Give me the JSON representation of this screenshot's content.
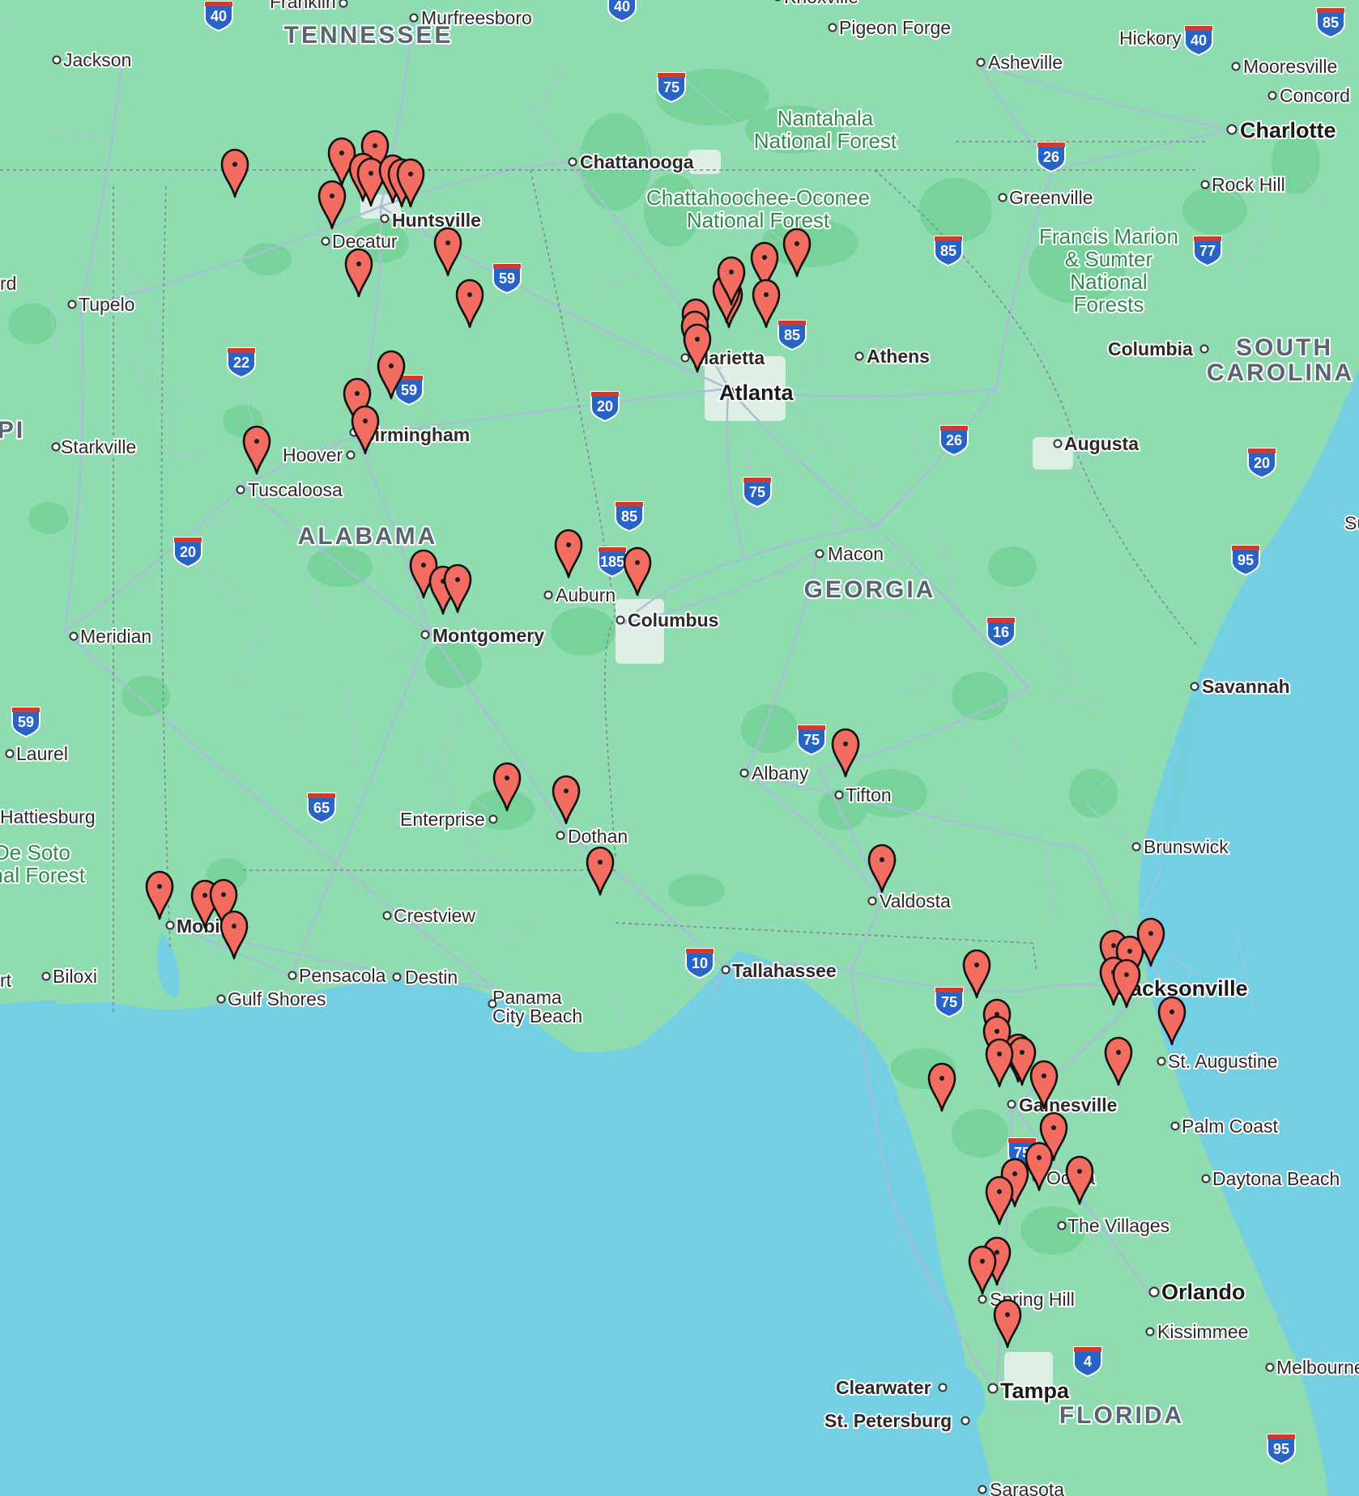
{
  "map": {
    "colors": {
      "water": "#74cfe2",
      "land": "#8fdcb0",
      "forest": "#6fcc93",
      "roads": "#a5b7d4",
      "border": "#7d8a8a",
      "urban": "#e3ecea",
      "marker": "#f26d60",
      "marker_outline": "#111111",
      "interstate": "#2864c5",
      "interstate_top": "#d23a2f"
    },
    "states": [
      {
        "name": "TENNESSEE"
      },
      {
        "name": "ALABAMA"
      },
      {
        "name": "GEORGIA"
      },
      {
        "name": "SOUTH"
      },
      {
        "name": "CAROLINA"
      },
      {
        "name": "FLORIDA"
      },
      {
        "name": "PI"
      }
    ],
    "forests": [
      {
        "name": "Nantahala"
      },
      {
        "name": "National Forest"
      },
      {
        "name": "Chattahoochee-Oconee"
      },
      {
        "name": "National Forest"
      },
      {
        "name": "Francis Marion"
      },
      {
        "name": "& Sumter"
      },
      {
        "name": "National"
      },
      {
        "name": "Forests"
      },
      {
        "name": "De Soto"
      },
      {
        "name": "onal Forest"
      }
    ],
    "cities": [
      {
        "name": "Franklin"
      },
      {
        "name": "Murfreesboro"
      },
      {
        "name": "Knoxville"
      },
      {
        "name": "Pigeon Forge"
      },
      {
        "name": "Hickory"
      },
      {
        "name": "Asheville"
      },
      {
        "name": "Mooresville"
      },
      {
        "name": "Concord"
      },
      {
        "name": "Charlotte"
      },
      {
        "name": "Jackson"
      },
      {
        "name": "Chattanooga"
      },
      {
        "name": "Rock Hill"
      },
      {
        "name": "Greenville"
      },
      {
        "name": "Huntsville"
      },
      {
        "name": "Decatur"
      },
      {
        "name": "rd"
      },
      {
        "name": "Tupelo"
      },
      {
        "name": "Columbia"
      },
      {
        "name": "Marietta"
      },
      {
        "name": "Athens"
      },
      {
        "name": "Atlanta"
      },
      {
        "name": "Birmingham"
      },
      {
        "name": "Hoover"
      },
      {
        "name": "Starkville"
      },
      {
        "name": "Augusta"
      },
      {
        "name": "Tuscaloosa"
      },
      {
        "name": "Sur"
      },
      {
        "name": "Macon"
      },
      {
        "name": "Auburn"
      },
      {
        "name": "Columbus"
      },
      {
        "name": "Montgomery"
      },
      {
        "name": "Meridian"
      },
      {
        "name": "Savannah"
      },
      {
        "name": "Laurel"
      },
      {
        "name": "Albany"
      },
      {
        "name": "Tifton"
      },
      {
        "name": "Hattiesburg"
      },
      {
        "name": "Enterprise"
      },
      {
        "name": "Dothan"
      },
      {
        "name": "Brunswick"
      },
      {
        "name": "Valdosta"
      },
      {
        "name": "Mobile"
      },
      {
        "name": "Crestview"
      },
      {
        "name": "Biloxi"
      },
      {
        "name": "rt"
      },
      {
        "name": "Pensacola"
      },
      {
        "name": "Destin"
      },
      {
        "name": "Tallahassee"
      },
      {
        "name": "Jacksonville"
      },
      {
        "name": "Gulf Shores"
      },
      {
        "name": "Panama"
      },
      {
        "name": "City Beach"
      },
      {
        "name": "St. Augustine"
      },
      {
        "name": "Gainesville"
      },
      {
        "name": "Palm Coast"
      },
      {
        "name": "Ocala"
      },
      {
        "name": "Daytona Beach"
      },
      {
        "name": "The Villages"
      },
      {
        "name": "Orlando"
      },
      {
        "name": "Spring Hill"
      },
      {
        "name": "Kissimmee"
      },
      {
        "name": "Clearwater"
      },
      {
        "name": "Tampa"
      },
      {
        "name": "Melbourne"
      },
      {
        "name": "St. Petersburg"
      },
      {
        "name": "Sarasota"
      }
    ],
    "shields": [
      {
        "num": "40"
      },
      {
        "num": "40"
      },
      {
        "num": "85"
      },
      {
        "num": "75"
      },
      {
        "num": "26"
      },
      {
        "num": "85"
      },
      {
        "num": "77"
      },
      {
        "num": "59"
      },
      {
        "num": "85"
      },
      {
        "num": "22"
      },
      {
        "num": "59"
      },
      {
        "num": "20"
      },
      {
        "num": "20"
      },
      {
        "num": "26"
      },
      {
        "num": "75"
      },
      {
        "num": "85"
      },
      {
        "num": "185"
      },
      {
        "num": "20"
      },
      {
        "num": "95"
      },
      {
        "num": "16"
      },
      {
        "num": "59"
      },
      {
        "num": "75"
      },
      {
        "num": "65"
      },
      {
        "num": "10"
      },
      {
        "num": "75"
      },
      {
        "num": "75"
      },
      {
        "num": "4"
      },
      {
        "num": "95"
      },
      {
        "num": "40"
      }
    ],
    "marker_count": 62
  }
}
